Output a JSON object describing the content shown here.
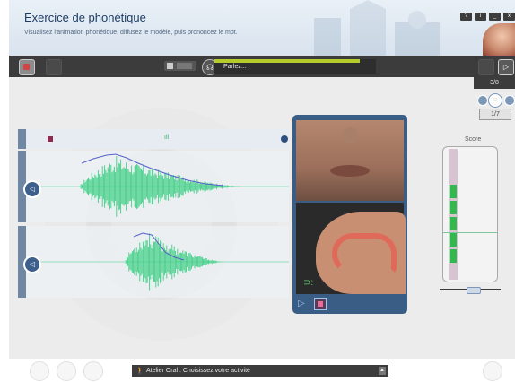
{
  "header": {
    "title": "Exercice de phonétique",
    "subtitle": "Visualisez l'animation phonétique, diffusez le modèle, puis prononcez le mot."
  },
  "window_controls": [
    "?",
    "i",
    "_",
    "x"
  ],
  "toolbar": {
    "status_label": "Parlez...",
    "progress_fraction": 0.9,
    "step_counter": "3/8"
  },
  "navigator": {
    "counter": "1/7"
  },
  "waveforms": {
    "model_color": "#3fcf85",
    "pitch_color": "#5561c8"
  },
  "score": {
    "label": "Score"
  },
  "status_bar": {
    "text": "Atelier Oral : Choisissez votre activité"
  },
  "icons": {
    "home": "home-icon",
    "mic": "microphone-icon",
    "next": "next-icon",
    "speaker": "speaker-icon",
    "play": "play-icon",
    "stop": "stop-icon",
    "activity": "walking-person-icon"
  }
}
